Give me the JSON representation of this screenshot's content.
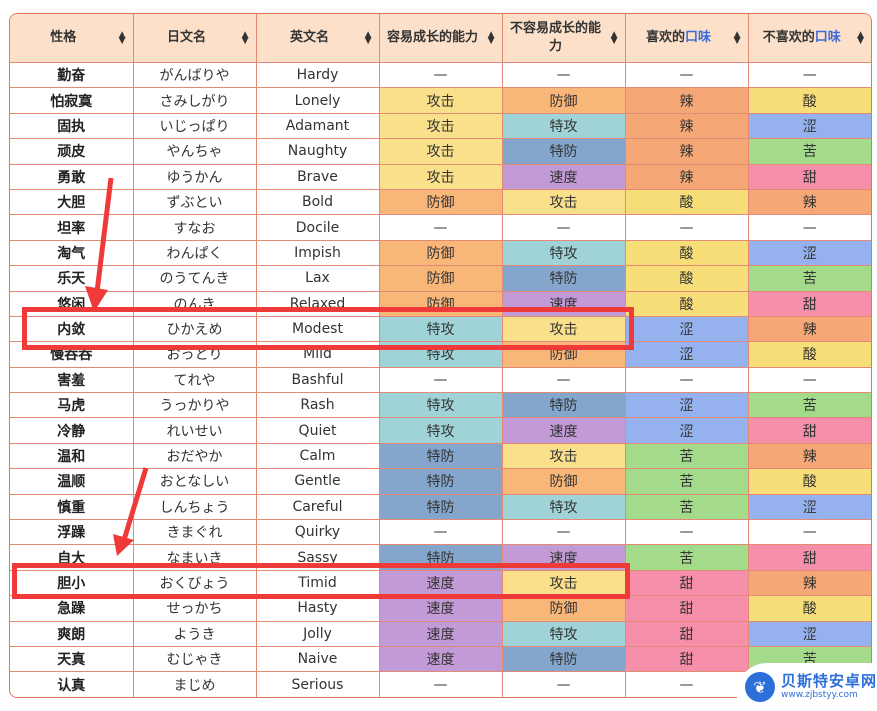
{
  "table": {
    "headers": [
      {
        "label": "性格",
        "pre": "性格",
        "hl": ""
      },
      {
        "label": "日文名",
        "pre": "日文名",
        "hl": ""
      },
      {
        "label": "英文名",
        "pre": "英文名",
        "hl": ""
      },
      {
        "label": "容易成长的能力",
        "pre": "容易成长的能力",
        "hl": ""
      },
      {
        "label": "不容易成长的能力",
        "pre": "不容易成长的能力",
        "hl": ""
      },
      {
        "label": "喜欢的口味",
        "pre": "喜欢的",
        "hl": "口味"
      },
      {
        "label": "不喜欢的口味",
        "pre": "不喜欢的",
        "hl": "口味"
      }
    ],
    "sort_icon": "sort-updown-icon",
    "rows": [
      [
        "勤奋",
        "がんばりや",
        "Hardy",
        "—",
        "—",
        "—",
        "—"
      ],
      [
        "怕寂寞",
        "さみしがり",
        "Lonely",
        "攻击",
        "防御",
        "辣",
        "酸"
      ],
      [
        "固执",
        "いじっぱり",
        "Adamant",
        "攻击",
        "特攻",
        "辣",
        "涩"
      ],
      [
        "顽皮",
        "やんちゃ",
        "Naughty",
        "攻击",
        "特防",
        "辣",
        "苦"
      ],
      [
        "勇敢",
        "ゆうかん",
        "Brave",
        "攻击",
        "速度",
        "辣",
        "甜"
      ],
      [
        "大胆",
        "ずぶとい",
        "Bold",
        "防御",
        "攻击",
        "酸",
        "辣"
      ],
      [
        "坦率",
        "すなお",
        "Docile",
        "—",
        "—",
        "—",
        "—"
      ],
      [
        "淘气",
        "わんぱく",
        "Impish",
        "防御",
        "特攻",
        "酸",
        "涩"
      ],
      [
        "乐天",
        "のうてんき",
        "Lax",
        "防御",
        "特防",
        "酸",
        "苦"
      ],
      [
        "悠闲",
        "のんき",
        "Relaxed",
        "防御",
        "速度",
        "酸",
        "甜"
      ],
      [
        "内敛",
        "ひかえめ",
        "Modest",
        "特攻",
        "攻击",
        "涩",
        "辣"
      ],
      [
        "慢吞吞",
        "おっとり",
        "Mild",
        "特攻",
        "防御",
        "涩",
        "酸"
      ],
      [
        "害羞",
        "てれや",
        "Bashful",
        "—",
        "—",
        "—",
        "—"
      ],
      [
        "马虎",
        "うっかりや",
        "Rash",
        "特攻",
        "特防",
        "涩",
        "苦"
      ],
      [
        "冷静",
        "れいせい",
        "Quiet",
        "特攻",
        "速度",
        "涩",
        "甜"
      ],
      [
        "温和",
        "おだやか",
        "Calm",
        "特防",
        "攻击",
        "苦",
        "辣"
      ],
      [
        "温顺",
        "おとなしい",
        "Gentle",
        "特防",
        "防御",
        "苦",
        "酸"
      ],
      [
        "慎重",
        "しんちょう",
        "Careful",
        "特防",
        "特攻",
        "苦",
        "涩"
      ],
      [
        "浮躁",
        "きまぐれ",
        "Quirky",
        "—",
        "—",
        "—",
        "—"
      ],
      [
        "自大",
        "なまいき",
        "Sassy",
        "特防",
        "速度",
        "苦",
        "甜"
      ],
      [
        "胆小",
        "おくびょう",
        "Timid",
        "速度",
        "攻击",
        "甜",
        "辣"
      ],
      [
        "急躁",
        "せっかち",
        "Hasty",
        "速度",
        "防御",
        "甜",
        "酸"
      ],
      [
        "爽朗",
        "ようき",
        "Jolly",
        "速度",
        "特攻",
        "甜",
        "涩"
      ],
      [
        "天真",
        "むじゃき",
        "Naive",
        "速度",
        "特防",
        "甜",
        "苦"
      ],
      [
        "认真",
        "まじめ",
        "Serious",
        "—",
        "—",
        "—",
        "—"
      ]
    ]
  },
  "colors": {
    "stat": {
      "攻击": "#fbe08c",
      "防御": "#f8b679",
      "特攻": "#9fd3d7",
      "特防": "#84a6cc",
      "速度": "#c29ad6",
      "—": "#ffffff"
    },
    "flavor": {
      "辣": "#f5a876",
      "酸": "#f7de78",
      "涩": "#95b1ee",
      "苦": "#a3db8a",
      "甜": "#f68fa9",
      "—": "#ffffff"
    },
    "header_bg": "#fde0c9",
    "border": "#e38a76",
    "highlight_box": "#f03a3a",
    "header_accent": "#3a6bd8"
  },
  "annotations": {
    "highlighted_rows": [
      "内敛",
      "胆小"
    ],
    "arrows": 2
  },
  "watermark": {
    "title": "贝斯特安卓网",
    "url": "www.zjbstyy.com",
    "icon": "shell-logo-icon"
  }
}
